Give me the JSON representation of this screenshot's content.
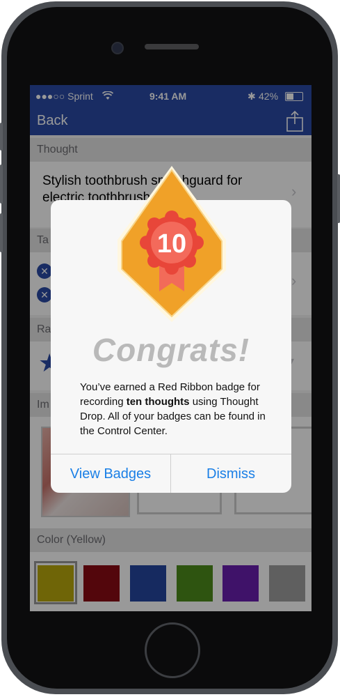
{
  "status": {
    "carrier": "●●●○○ Sprint",
    "time": "9:41 AM",
    "battery": "42%"
  },
  "nav": {
    "back": "Back"
  },
  "sections": {
    "thought": "Thought",
    "tags": "Ta",
    "rating": "Ra",
    "images": "Im",
    "color": "Color (Yellow)"
  },
  "thought_text": "Stylish toothbrush splashguard for electric toothbrush",
  "colors": [
    "#b9a90c",
    "#8b0b14",
    "#2647a1",
    "#4d8d1b",
    "#6a1fb0",
    "#9e9e9e"
  ],
  "badge": {
    "number": "10",
    "name": "Red Ribbon"
  },
  "alert": {
    "title": "Congrats!",
    "msg_1": "You’ve earned a Red Ribbon badge for recording ",
    "msg_bold": "ten thoughts",
    "msg_2": " using Thought Drop. All of your badges can be found in the Control Center.",
    "view_badges": "View Badges",
    "dismiss": "Dismiss"
  }
}
